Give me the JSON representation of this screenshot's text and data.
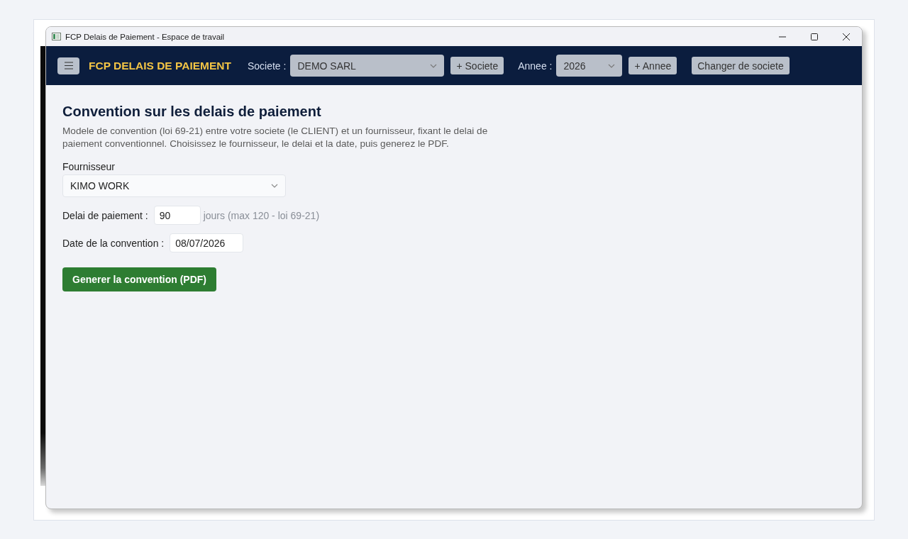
{
  "window": {
    "title": "FCP Delais de Paiement - Espace de travail"
  },
  "navbar": {
    "app_name": "FCP DELAIS DE PAIEMENT",
    "company": {
      "label": "Societe :",
      "value": "DEMO SARL"
    },
    "add_company_button": "+ Societe",
    "year": {
      "label": "Annee :",
      "value": "2026"
    },
    "add_year_button": "+ Annee",
    "switch_company_button": "Changer de societe"
  },
  "page": {
    "title": "Convention sur les delais de paiement",
    "description": "Modele de convention (loi 69-21) entre votre societe (le CLIENT) et un fournisseur, fixant le delai de paiement conventionnel. Choisissez le fournisseur, le delai et la date, puis generez le PDF.",
    "supplier": {
      "label": "Fournisseur",
      "value": "KIMO WORK"
    },
    "payment_delay": {
      "label": "Delai de paiement :",
      "value": "90",
      "hint": "jours (max 120 - loi 69-21)"
    },
    "convention_date": {
      "label": "Date de la convention :",
      "value": "08/07/2026"
    },
    "generate_button": "Generer la convention (PDF)"
  }
}
